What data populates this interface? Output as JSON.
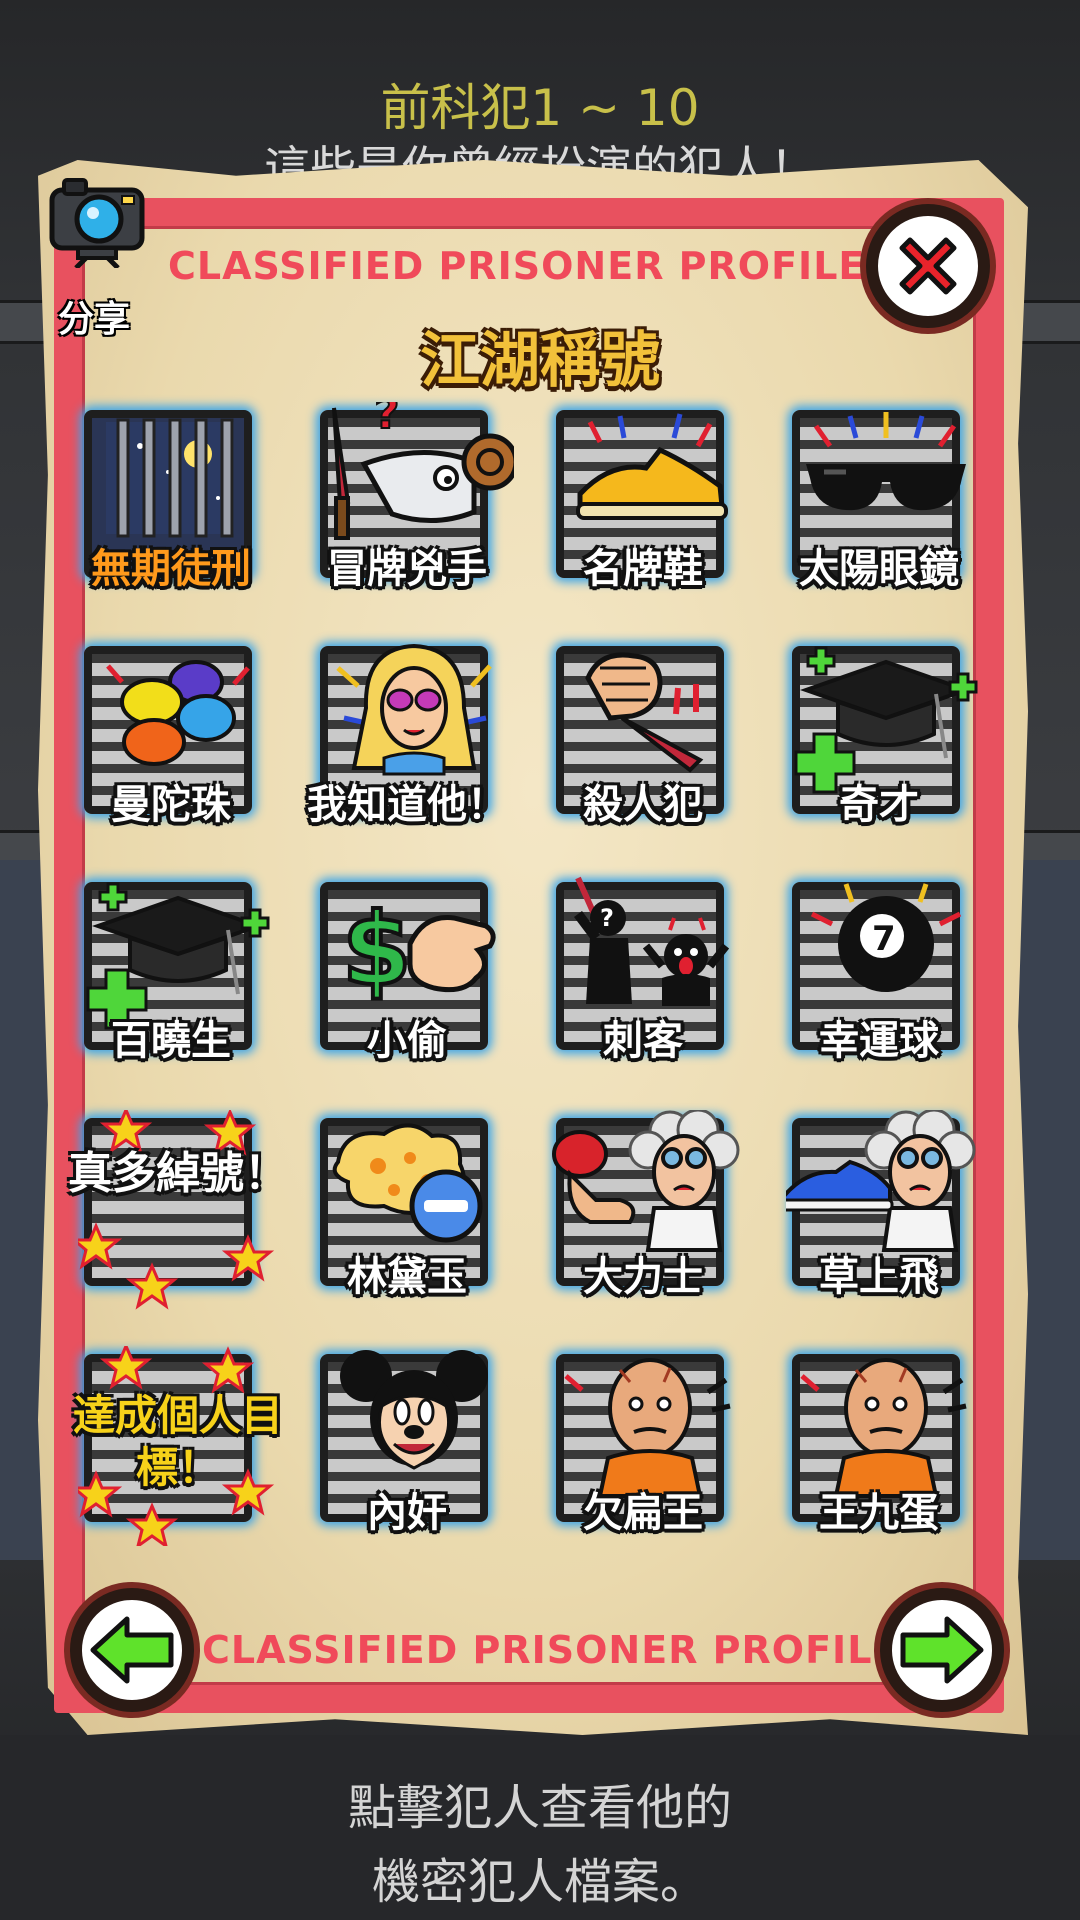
{
  "header": {
    "title": "前科犯1 ~ 10",
    "subtitle": "這些是你曾經扮演的犯人！"
  },
  "profile": {
    "classified_top": "CLASSIFIED PRISONER PROFILE",
    "classified_bottom": "CLASSIFIED PRISONER PROFILE",
    "section_title": "江湖稱號",
    "share_label": "分享"
  },
  "badges": [
    {
      "label": "無期徒刑",
      "icon": "jail-cell-icon"
    },
    {
      "label": "冒牌兇手",
      "icon": "goat-knife-icon"
    },
    {
      "label": "名牌鞋",
      "icon": "sneaker-icon"
    },
    {
      "label": "太陽眼鏡",
      "icon": "sunglasses-icon"
    },
    {
      "label": "曼陀珠",
      "icon": "candy-icon"
    },
    {
      "label": "我知道他！",
      "icon": "blonde-woman-icon"
    },
    {
      "label": "殺人犯",
      "icon": "fist-knife-icon"
    },
    {
      "label": "奇才",
      "icon": "graduation-cap-icon"
    },
    {
      "label": "百曉生",
      "icon": "graduation-cap-icon"
    },
    {
      "label": "小偷",
      "icon": "money-hand-icon"
    },
    {
      "label": "刺客",
      "icon": "assassin-silhouette-icon"
    },
    {
      "label": "幸運球",
      "icon": "eight-ball-icon"
    },
    {
      "label": "真多綽號！",
      "icon": "stars-icon"
    },
    {
      "label": "林黛玉",
      "icon": "popcorn-minus-icon"
    },
    {
      "label": "大力士",
      "icon": "boxing-scientist-icon"
    },
    {
      "label": "草上飛",
      "icon": "shoe-scientist-icon"
    },
    {
      "label": "達成個人目標！",
      "icon": "stars-icon"
    },
    {
      "label": "內奸",
      "icon": "mouse-face-icon"
    },
    {
      "label": "欠扁王",
      "icon": "bald-prisoner-icon"
    },
    {
      "label": "王九蛋",
      "icon": "bald-prisoner-icon"
    }
  ],
  "footer": {
    "line1": "點擊犯人查看他的",
    "line2": "機密犯人檔案。"
  },
  "colors": {
    "frame_red": "#e8515f",
    "title_gold": "#f2c13a",
    "glow_blue": "#3aa4e8",
    "arrow_green": "#5fe22b",
    "close_red": "#e8232b"
  }
}
